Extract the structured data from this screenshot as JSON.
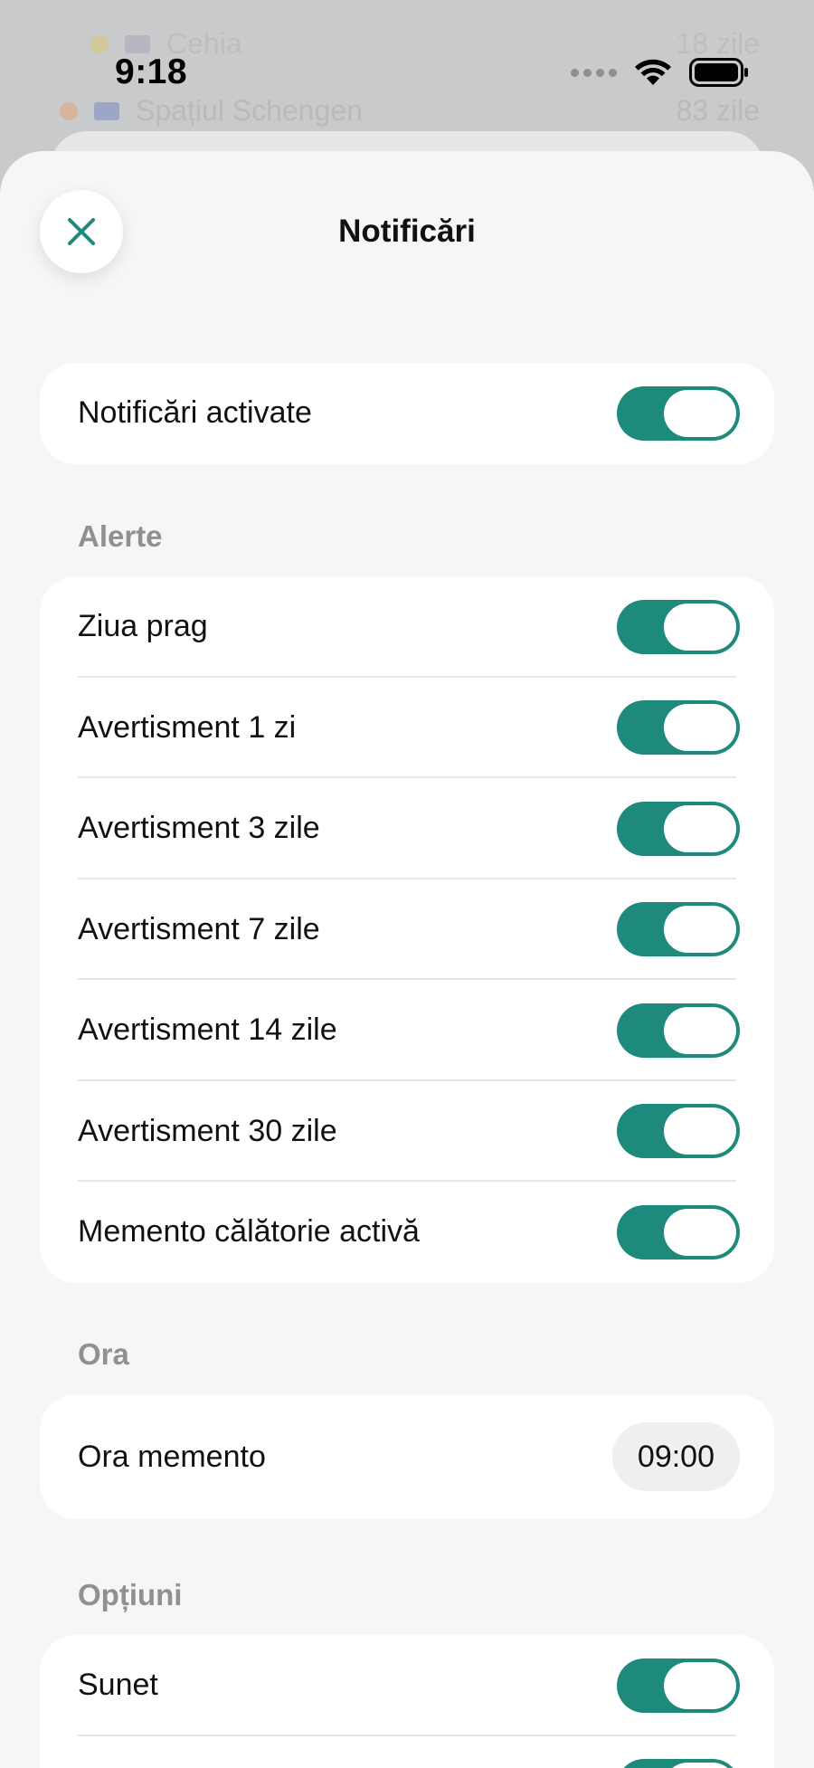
{
  "status_bar": {
    "time": "9:18"
  },
  "background_list": [
    {
      "name": "Cehia",
      "value": "18 zile"
    },
    {
      "name": "Spațiul Schengen",
      "value": "83 zile"
    }
  ],
  "header": {
    "title": "Notificări"
  },
  "master": {
    "label": "Notificări activate",
    "enabled": true
  },
  "sections": {
    "alerts": {
      "title": "Alerte",
      "items": [
        {
          "label": "Ziua prag",
          "enabled": true
        },
        {
          "label": "Avertisment 1 zi",
          "enabled": true
        },
        {
          "label": "Avertisment 3 zile",
          "enabled": true
        },
        {
          "label": "Avertisment 7 zile",
          "enabled": true
        },
        {
          "label": "Avertisment 14 zile",
          "enabled": true
        },
        {
          "label": "Avertisment 30 zile",
          "enabled": true
        },
        {
          "label": "Memento călătorie activă",
          "enabled": true
        }
      ]
    },
    "time": {
      "title": "Ora",
      "reminder_label": "Ora memento",
      "reminder_value": "09:00"
    },
    "options": {
      "title": "Opțiuni",
      "items": [
        {
          "label": "Sunet",
          "enabled": true
        }
      ]
    }
  },
  "colors": {
    "accent": "#1e8a7b",
    "sheet_background": "#f5f6f6",
    "card_background": "#ffffff",
    "section_label": "#8f9091"
  },
  "icons": {
    "close": "close-icon",
    "wifi": "wifi-icon",
    "battery": "battery-icon",
    "signal": "signal-icon"
  }
}
